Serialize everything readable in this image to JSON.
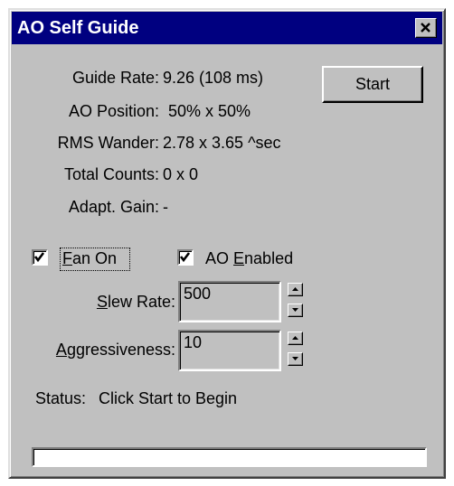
{
  "window": {
    "title": "AO Self Guide",
    "close_glyph": "✕"
  },
  "stats": {
    "guide_rate_label": "Guide Rate:",
    "guide_rate_value": "9.26 (108 ms)",
    "ao_position_label": "AO Position:",
    "ao_position_value": "50% x  50%",
    "rms_wander_label": "RMS Wander:",
    "rms_wander_value": "2.78 x 3.65 ^sec",
    "total_counts_label": "Total Counts:",
    "total_counts_value": "0 x 0",
    "adapt_gain_label": "Adapt. Gain:",
    "adapt_gain_value": "-"
  },
  "start_button": {
    "label": "Start"
  },
  "fan_on": {
    "mnemonic": "F",
    "rest": "an On",
    "checked": true
  },
  "ao_enabled": {
    "prefix": "AO ",
    "mnemonic": "E",
    "rest": "nabled",
    "checked": true
  },
  "slew_rate": {
    "mnemonic": "S",
    "rest": "lew Rate:",
    "value": "500"
  },
  "aggressiveness": {
    "mnemonic": "A",
    "rest": "ggressiveness:",
    "value": "10"
  },
  "status": {
    "label": "Status:",
    "value": "Click Start to Begin"
  },
  "progress": {
    "value": 0
  },
  "icons": {
    "close": "close-icon",
    "check": "checkmark-icon",
    "spin_up": "arrow-up-icon",
    "spin_down": "arrow-down-icon"
  },
  "colors": {
    "titlebar": "#000080",
    "face": "#c0c0c0"
  }
}
